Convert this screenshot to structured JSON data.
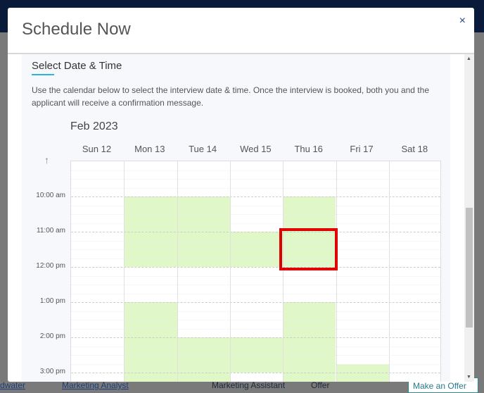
{
  "background": {
    "row": [
      "dwater",
      "Marketing Analyst",
      "Marketing Assistant",
      "Offer"
    ],
    "offer_button": "Make an Offer"
  },
  "modal": {
    "title": "Schedule Now",
    "close": "×",
    "section_title": "Select Date & Time",
    "description": "Use the calendar below to select the interview date & time. Once the interview is booked, both you and the applicant will receive a confirmation message.",
    "month": "Feb 2023",
    "days": [
      "Sun 12",
      "Mon 13",
      "Tue 14",
      "Wed 15",
      "Thu 16",
      "Fri 17",
      "Sat 18"
    ],
    "times": [
      "10:00 am",
      "11:00 am",
      "12:00 pm",
      "1:00 pm",
      "2:00 pm",
      "3:00 pm"
    ],
    "availability_color": "#e0f8c8",
    "available_slots": [
      {
        "day": 1,
        "start": 10,
        "end": 12
      },
      {
        "day": 1,
        "start": 13,
        "end": 15.5
      },
      {
        "day": 2,
        "start": 10,
        "end": 12
      },
      {
        "day": 2,
        "start": 14,
        "end": 15.5
      },
      {
        "day": 3,
        "start": 11,
        "end": 12
      },
      {
        "day": 3,
        "start": 14,
        "end": 15
      },
      {
        "day": 4,
        "start": 10,
        "end": 12
      },
      {
        "day": 4,
        "start": 13,
        "end": 15.5
      },
      {
        "day": 5,
        "start": 14.75,
        "end": 15.5
      }
    ],
    "selected": {
      "day": "Thu 16",
      "start": "11:00 am",
      "end": "12:00 pm"
    }
  }
}
